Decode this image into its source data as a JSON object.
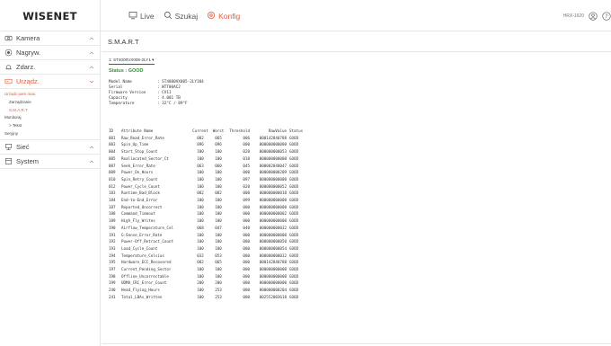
{
  "brand": {
    "logo_text": "WISENET"
  },
  "nav": [
    {
      "label": "Live",
      "icon": "monitor-icon"
    },
    {
      "label": "Szukaj",
      "icon": "search-icon"
    },
    {
      "label": "Konfig",
      "icon": "settings-icon",
      "active": true
    }
  ],
  "header_right": {
    "user": "HRX-1620",
    "icons": [
      "user-icon",
      "help-icon"
    ]
  },
  "colors": {
    "accent": "#e25b3c",
    "status_good": "#3b8f3b",
    "border": "#e6e6e6"
  },
  "sidebar": {
    "items": [
      {
        "label": "Kamera",
        "icon": "camera-icon"
      },
      {
        "label": "Nagryw.",
        "icon": "record-icon"
      },
      {
        "label": "Zdarz.",
        "icon": "event-icon"
      },
      {
        "label": "Urządz.",
        "icon": "device-icon",
        "active": true
      },
      {
        "label": "Sieć",
        "icon": "network-icon"
      },
      {
        "label": "System",
        "icon": "system-icon"
      }
    ],
    "device_sub": [
      "Urządz.pam.mas.",
      "Zarządzanie",
      "S.M.A.R.T",
      "Monitoraj",
      "> Tekst",
      "Seryjny"
    ]
  },
  "page": {
    "title": "S.M.A.R.T",
    "disk_select": "1: ST4000VX005-2LY1 ▾",
    "status": "Status : GOOD",
    "info": [
      {
        "label": "Model Name",
        "value": ": ST4000VX005-2LY104"
      },
      {
        "label": "Serial",
        "value": ": WTT00AC2"
      },
      {
        "label": "Firmware Version",
        "value": ": CV11"
      },
      {
        "label": "Capacity",
        "value": ": 4.001 TB"
      },
      {
        "label": "Temperature",
        "value": ": 32°C / 89°F"
      }
    ]
  },
  "table": {
    "headers": [
      "ID",
      "Attribute Name",
      "Current",
      "Worst",
      "Threshold",
      "RawValue",
      "Status"
    ],
    "rows": [
      [
        "001",
        "Raw_Read_Error_Rate",
        "082",
        "065",
        "006",
        "000142840788",
        "GOOD"
      ],
      [
        "003",
        "Spin_Up_Time",
        "096",
        "096",
        "000",
        "000000000000",
        "GOOD"
      ],
      [
        "004",
        "Start_Stop_Count",
        "100",
        "100",
        "020",
        "000000000053",
        "GOOD"
      ],
      [
        "005",
        "Reallocated_Sector_Ct",
        "100",
        "100",
        "010",
        "000000000000",
        "GOOD"
      ],
      [
        "007",
        "Seek_Error_Rate",
        "063",
        "060",
        "045",
        "000002040047",
        "GOOD"
      ],
      [
        "009",
        "Power_On_Hours",
        "100",
        "100",
        "000",
        "000000000209",
        "GOOD"
      ],
      [
        "010",
        "Spin_Retry_Count",
        "100",
        "100",
        "097",
        "000000000000",
        "GOOD"
      ],
      [
        "012",
        "Power_Cycle_Count",
        "100",
        "100",
        "020",
        "000000000052",
        "GOOD"
      ],
      [
        "183",
        "Runtime_Bad_Block",
        "082",
        "082",
        "000",
        "000000000018",
        "GOOD"
      ],
      [
        "184",
        "End-to-End_Error",
        "100",
        "100",
        "099",
        "000000000000",
        "GOOD"
      ],
      [
        "187",
        "Reported_Uncorrect",
        "100",
        "100",
        "000",
        "000000000000",
        "GOOD"
      ],
      [
        "188",
        "Command_Timeout",
        "100",
        "100",
        "000",
        "000000000002",
        "GOOD"
      ],
      [
        "189",
        "High_Fly_Writes",
        "100",
        "100",
        "000",
        "000000000000",
        "GOOD"
      ],
      [
        "190",
        "Airflow_Temperature_Cel",
        "068",
        "047",
        "040",
        "000000000032",
        "GOOD"
      ],
      [
        "191",
        "G-Sense_Error_Rate",
        "100",
        "100",
        "000",
        "000000000000",
        "GOOD"
      ],
      [
        "192",
        "Power-Off_Retract_Count",
        "100",
        "100",
        "000",
        "000000000050",
        "GOOD"
      ],
      [
        "193",
        "Load_Cycle_Count",
        "100",
        "100",
        "000",
        "000000000054",
        "GOOD"
      ],
      [
        "194",
        "Temperature_Celsius",
        "032",
        "053",
        "000",
        "000000000032",
        "GOOD"
      ],
      [
        "195",
        "Hardware_ECC_Recovered",
        "082",
        "065",
        "000",
        "000142840788",
        "GOOD"
      ],
      [
        "197",
        "Current_Pending_Sector",
        "100",
        "100",
        "000",
        "000000000000",
        "GOOD"
      ],
      [
        "198",
        "Offline_Uncorrectable",
        "100",
        "100",
        "000",
        "000000000000",
        "GOOD"
      ],
      [
        "199",
        "UDMA_CRC_Error_Count",
        "200",
        "200",
        "000",
        "000000000000",
        "GOOD"
      ],
      [
        "240",
        "Head_Flying_Hours",
        "100",
        "253",
        "000",
        "000000000204",
        "GOOD"
      ],
      [
        "241",
        "Total_LBAs_Written",
        "100",
        "253",
        "000",
        "002552003618",
        "GOOD"
      ]
    ]
  }
}
